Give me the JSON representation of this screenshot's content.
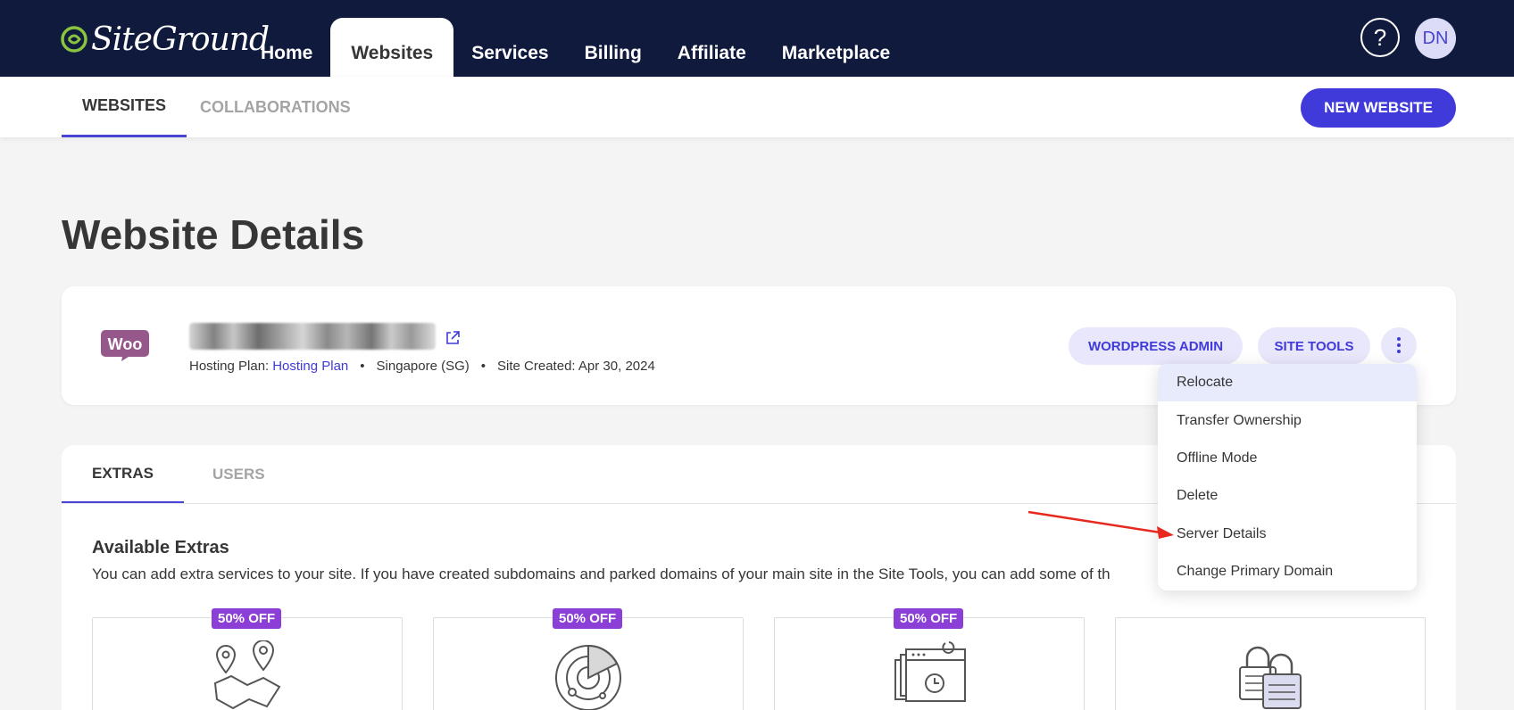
{
  "brand": {
    "name": "SiteGround"
  },
  "nav": {
    "items": [
      {
        "label": "Home"
      },
      {
        "label": "Websites",
        "active": true
      },
      {
        "label": "Services"
      },
      {
        "label": "Billing"
      },
      {
        "label": "Affiliate"
      },
      {
        "label": "Marketplace"
      }
    ],
    "help_label": "?",
    "avatar_initials": "DN"
  },
  "subnav": {
    "tabs": [
      {
        "label": "WEBSITES",
        "active": true
      },
      {
        "label": "COLLABORATIONS",
        "active": false
      }
    ],
    "new_website_label": "NEW WEBSITE"
  },
  "page": {
    "title": "Website Details"
  },
  "site": {
    "logo_text": "Woo",
    "hosting_plan_label": "Hosting Plan:",
    "hosting_plan_value": "Hosting Plan",
    "location": "Singapore (SG)",
    "created": "Site Created: Apr 30, 2024",
    "separator": "•",
    "wordpress_admin_label": "WORDPRESS ADMIN",
    "site_tools_label": "SITE TOOLS"
  },
  "menu": {
    "items": [
      {
        "label": "Relocate",
        "highlighted": true
      },
      {
        "label": "Transfer Ownership"
      },
      {
        "label": "Offline Mode"
      },
      {
        "label": "Delete"
      },
      {
        "label": "Server Details"
      },
      {
        "label": "Change Primary Domain"
      }
    ]
  },
  "extras": {
    "tabs": [
      {
        "label": "EXTRAS",
        "active": true
      },
      {
        "label": "USERS",
        "active": false
      }
    ],
    "title": "Available Extras",
    "description": "You can add extra services to your site. If you have created subdomains and parked domains of your main site in the Site Tools, you can add some of th",
    "cards": [
      {
        "badge": "50% OFF",
        "icon": "map-pins-icon"
      },
      {
        "badge": "50% OFF",
        "icon": "radar-scan-icon"
      },
      {
        "badge": "50% OFF",
        "icon": "scheduled-backup-icon"
      },
      {
        "badge": "",
        "icon": "padlocks-icon"
      }
    ]
  },
  "colors": {
    "topbar": "#101a3d",
    "accent": "#3f3ad9",
    "badge": "#8b3fd6",
    "annotation_arrow": "#e8281e"
  }
}
